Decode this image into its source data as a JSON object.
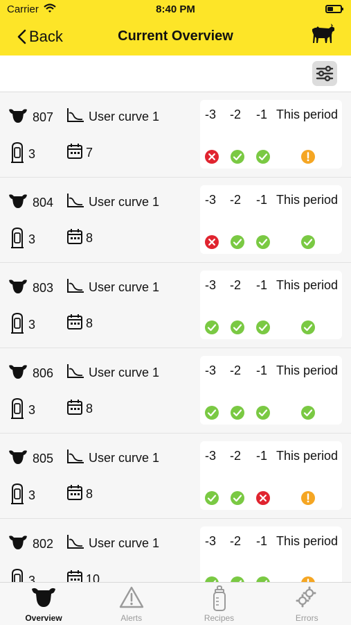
{
  "status_bar": {
    "carrier": "Carrier",
    "time": "8:40 PM"
  },
  "nav": {
    "back_label": "Back",
    "title": "Current Overview"
  },
  "period_headers": [
    "-3",
    "-2",
    "-1",
    "This period"
  ],
  "colors": {
    "accent": "#fde528",
    "ok": "#7ac943",
    "error": "#e0242f",
    "warning": "#f5a623"
  },
  "rows": [
    {
      "animal": "807",
      "curve": "User curve 1",
      "station": "3",
      "days": "7",
      "status": [
        "error",
        "ok",
        "ok",
        "warning"
      ]
    },
    {
      "animal": "804",
      "curve": "User curve 1",
      "station": "3",
      "days": "8",
      "status": [
        "error",
        "ok",
        "ok",
        "ok"
      ]
    },
    {
      "animal": "803",
      "curve": "User curve 1",
      "station": "3",
      "days": "8",
      "status": [
        "ok",
        "ok",
        "ok",
        "ok"
      ]
    },
    {
      "animal": "806",
      "curve": "User curve 1",
      "station": "3",
      "days": "8",
      "status": [
        "ok",
        "ok",
        "ok",
        "ok"
      ]
    },
    {
      "animal": "805",
      "curve": "User curve 1",
      "station": "3",
      "days": "8",
      "status": [
        "ok",
        "ok",
        "error",
        "warning"
      ]
    },
    {
      "animal": "802",
      "curve": "User curve 1",
      "station": "3",
      "days": "10",
      "status": [
        "ok",
        "ok",
        "ok",
        "warning"
      ]
    }
  ],
  "tabs": [
    {
      "label": "Overview",
      "icon": "cow-head-icon",
      "active": true
    },
    {
      "label": "Alerts",
      "icon": "alert-triangle-icon",
      "active": false
    },
    {
      "label": "Recipes",
      "icon": "bottle-icon",
      "active": false
    },
    {
      "label": "Errors",
      "icon": "gears-icon",
      "active": false
    }
  ]
}
